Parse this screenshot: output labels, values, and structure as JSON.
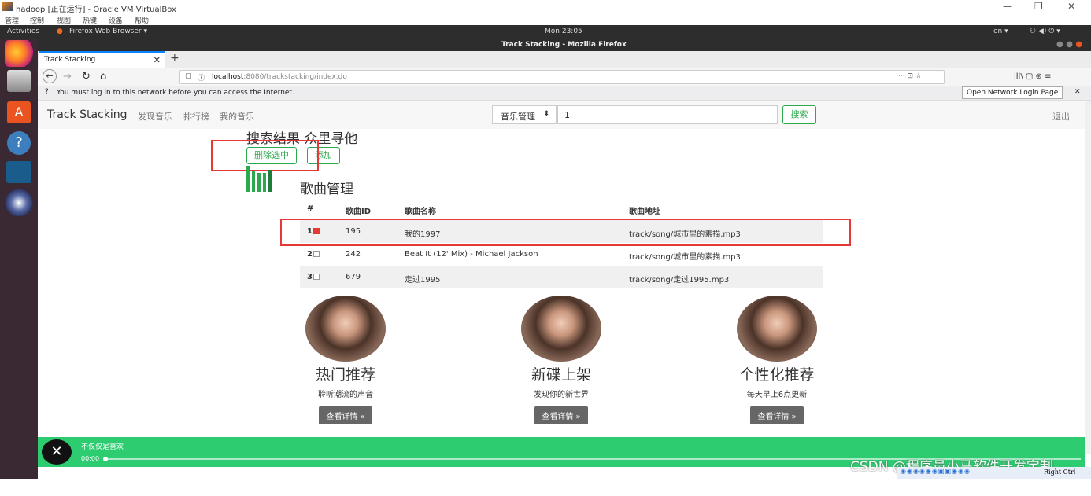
{
  "vbox": {
    "title": "hadoop [正在运行] - Oracle VM VirtualBox",
    "menu": [
      "管理",
      "控制",
      "视图",
      "热键",
      "设备",
      "帮助"
    ],
    "window_controls": [
      "—",
      "❐",
      "✕"
    ]
  },
  "gnome": {
    "activities": "Activities",
    "app_menu": "Firefox Web Browser ▾",
    "clock": "Mon 23:05",
    "lang": "en ▾",
    "status_icons": "⚇ ◀) ⏻ ▾"
  },
  "firefox": {
    "window_title": "Track Stacking - Mozilla Firefox",
    "tab_title": "Track Stacking",
    "tab_close": "✕",
    "new_tab": "+",
    "url_host": "localhost",
    "url_path": ":8080/trackstacking/index.do",
    "url_actions": "··· ⊡ ☆",
    "toolbar_right": "lll\\ ▢ ⊛ ≡",
    "notification": "You must log in to this network before you can access the Internet.",
    "notification_button": "Open Network Login Page",
    "notification_close": "✕"
  },
  "site": {
    "brand": "Track Stacking",
    "nav": [
      "发现音乐",
      "排行榜",
      "我的音乐"
    ],
    "search_category": "音乐管理",
    "search_value": "1",
    "search_button": "搜索",
    "logout": "退出"
  },
  "results": {
    "title": "搜索结果 众里寻他",
    "delete_button": "删除选中",
    "add_button": "添加",
    "section_title": "歌曲管理",
    "columns": [
      "#",
      "歌曲ID",
      "歌曲名称",
      "歌曲地址"
    ],
    "rows": [
      {
        "num": "1",
        "id": "195",
        "name": "我的1997",
        "path": "track/song/城市里的素描.mp3",
        "checked": true
      },
      {
        "num": "2",
        "id": "242",
        "name": "Beat It (12' Mix) - Michael Jackson",
        "path": "track/song/城市里的素描.mp3",
        "checked": false
      },
      {
        "num": "3",
        "id": "679",
        "name": "走过1995",
        "path": "track/song/走过1995.mp3",
        "checked": false
      }
    ]
  },
  "features": [
    {
      "title": "热门推荐",
      "subtitle": "聆听潮流的声音",
      "button": "查看详情 »"
    },
    {
      "title": "新碟上架",
      "subtitle": "发现你的新世界",
      "button": "查看详情 »"
    },
    {
      "title": "个性化推荐",
      "subtitle": "每天早上6点更新",
      "button": "查看详情 »"
    }
  ],
  "player": {
    "title": "不仅仅是喜欢",
    "time": "00:00",
    "progress": 0.0
  },
  "watermark": "CSDN @程序员小马软件开发定制",
  "host_key": "Right Ctrl",
  "colors": {
    "accent_green": "#2ecc71",
    "highlight_red": "#e53935"
  }
}
